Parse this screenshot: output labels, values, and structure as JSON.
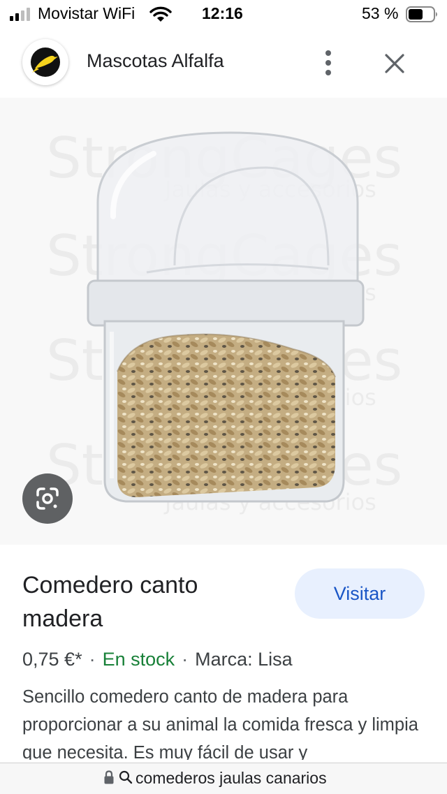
{
  "status_bar": {
    "carrier": "Movistar WiFi",
    "time": "12:16",
    "battery": "53 %",
    "icons": [
      "cellular-signal-icon",
      "wifi-icon",
      "battery-icon"
    ]
  },
  "header": {
    "site_name": "Mascotas Alfalfa",
    "logo": "canary-logo",
    "icons": [
      "more-vert-icon",
      "close-icon"
    ]
  },
  "image": {
    "watermark_brand": "StrongCages",
    "watermark_tagline": "Jaulas y accesorios",
    "lens_icon": "google-lens-icon"
  },
  "product": {
    "title": "Comedero canto madera",
    "visit_label": "Visitar",
    "price": "0,75 €*",
    "separator": "·",
    "stock": "En stock",
    "brand": "Marca: Lisa",
    "description": "Sencillo comedero canto de madera para proporcionar a su animal la comida fresca y limpia que necesita. Es muy fácil de usar y"
  },
  "url_bar": {
    "text": "comederos jaulas canarios",
    "icons": [
      "lock-icon",
      "search-icon"
    ]
  },
  "colors": {
    "stock_green": "#188038",
    "visit_blue": "#1a56c6",
    "visit_bg": "#e8f0fe"
  }
}
